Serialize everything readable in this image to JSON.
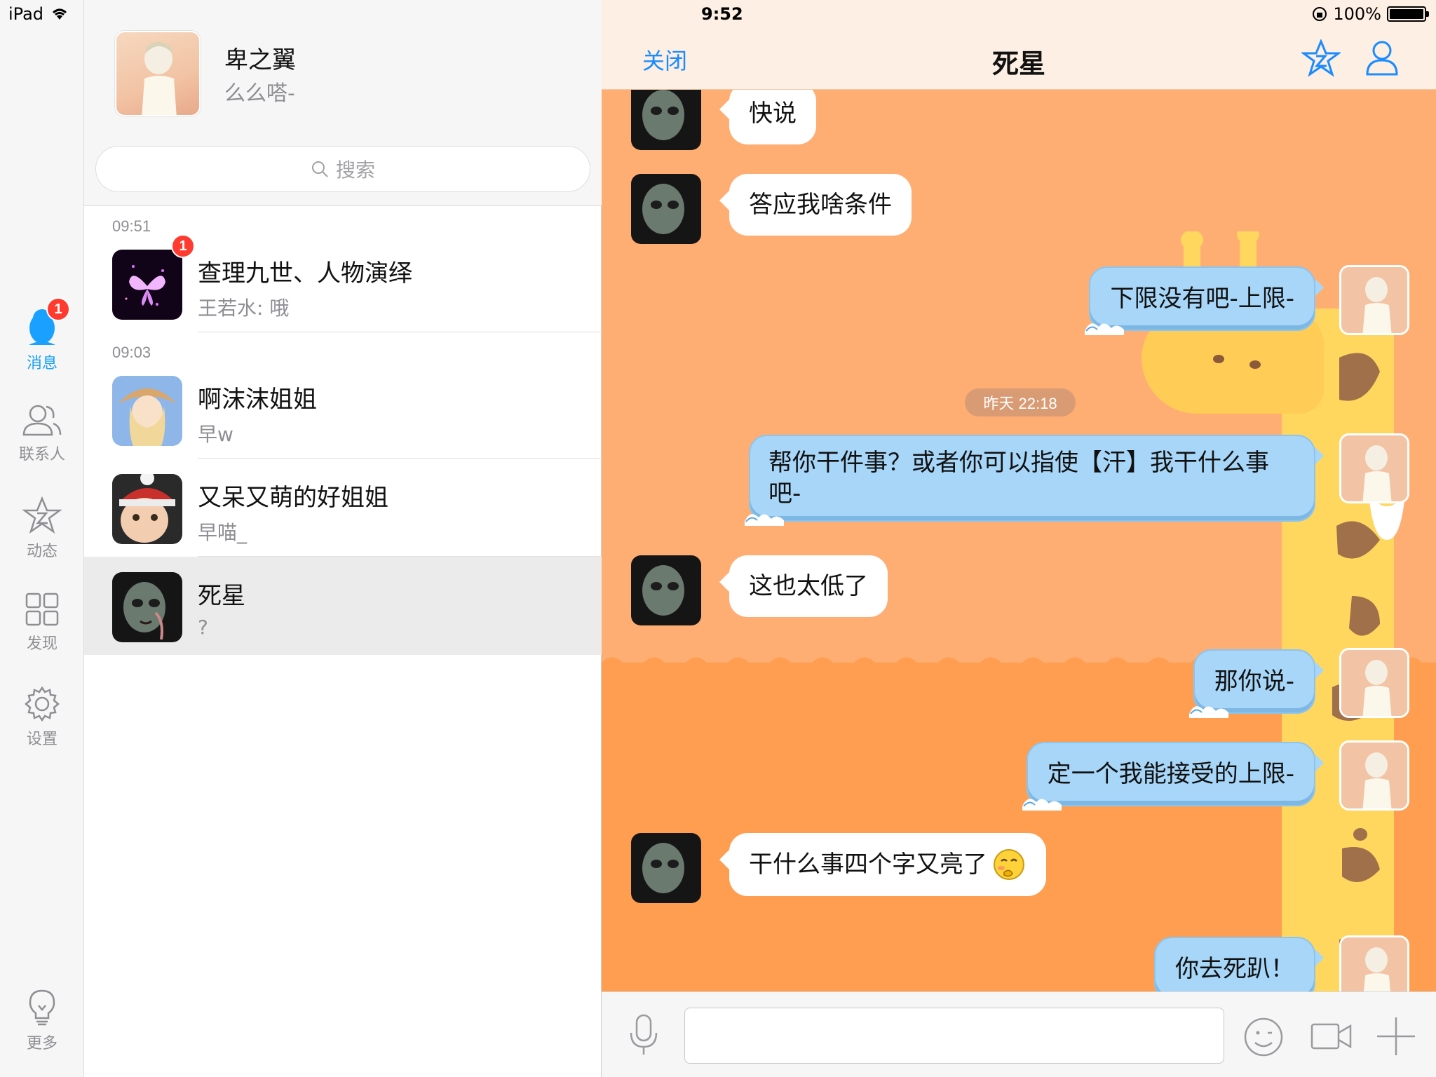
{
  "status_bar": {
    "device": "iPad",
    "time": "9:52",
    "battery": "100%"
  },
  "nav_rail": {
    "items": [
      {
        "label": "消息",
        "icon": "penguin-icon",
        "badge": "1",
        "active": true
      },
      {
        "label": "联系人",
        "icon": "contacts-icon"
      },
      {
        "label": "动态",
        "icon": "star-z-icon"
      },
      {
        "label": "发现",
        "icon": "grid-icon"
      },
      {
        "label": "设置",
        "icon": "gear-icon"
      },
      {
        "label": "更多",
        "icon": "lightbulb-icon"
      }
    ]
  },
  "profile": {
    "name": "卑之翼",
    "signature": "么么嗒-"
  },
  "search": {
    "placeholder": "搜索"
  },
  "conversations": [
    {
      "time": "09:51",
      "name": "查理九世、人物演绎",
      "preview": "王若水: 哦",
      "badge": "1"
    },
    {
      "time": "09:03",
      "name": "啊沫沫姐姐",
      "preview": "早w"
    },
    {
      "name": "又呆又萌的好姐姐",
      "preview": "早喵_"
    },
    {
      "name": "死星",
      "preview": "?",
      "selected": true
    }
  ],
  "chat": {
    "close_label": "关闭",
    "title": "死星",
    "timestamp": "昨天 22:18",
    "messages": [
      {
        "dir": "in",
        "text": "快说"
      },
      {
        "dir": "in",
        "text": "答应我啥条件"
      },
      {
        "dir": "out",
        "text": "下限没有吧-上限-"
      },
      {
        "dir": "out",
        "text": "帮你干件事？或者你可以指使【汗】我干什么事吧-"
      },
      {
        "dir": "in",
        "text": "这也太低了"
      },
      {
        "dir": "out",
        "text": "那你说-"
      },
      {
        "dir": "out",
        "text": "定一个我能接受的上限-"
      },
      {
        "dir": "in",
        "text": "干什么事四个字又亮了"
      },
      {
        "dir": "out",
        "text": "你去死趴！"
      }
    ]
  },
  "colors": {
    "accent": "#1a8cff",
    "badge": "#ff3b30",
    "chat_bg": "#ffae73",
    "out_bubble": "#a7d6f8"
  }
}
